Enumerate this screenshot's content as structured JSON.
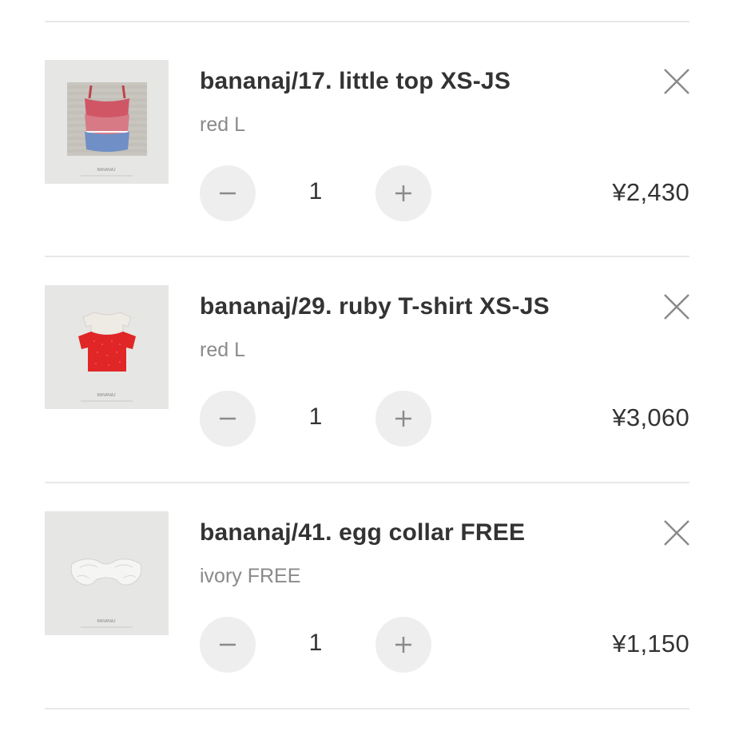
{
  "cart": {
    "items": [
      {
        "title": "bananaj/17. little top XS-JS",
        "variant": "red L",
        "quantity": "1",
        "price": "¥2,430",
        "image_icon": "product-photo-little-top",
        "brand_mark": "BANANAJ"
      },
      {
        "title": "bananaj/29. ruby T-shirt XS-JS",
        "variant": "red L",
        "quantity": "1",
        "price": "¥3,060",
        "image_icon": "product-photo-ruby-tshirt",
        "brand_mark": "BANANAJ"
      },
      {
        "title": "bananaj/41. egg collar FREE",
        "variant": "ivory FREE",
        "quantity": "1",
        "price": "¥1,150",
        "image_icon": "product-photo-egg-collar",
        "brand_mark": "BANANAJ"
      }
    ],
    "icons": {
      "remove": "close-icon",
      "decrement": "minus-icon",
      "increment": "plus-icon"
    },
    "colors": {
      "text": "#333333",
      "muted": "#8a8a8a",
      "button_bg": "#eeeeee",
      "divider": "#e8e8e8"
    }
  }
}
